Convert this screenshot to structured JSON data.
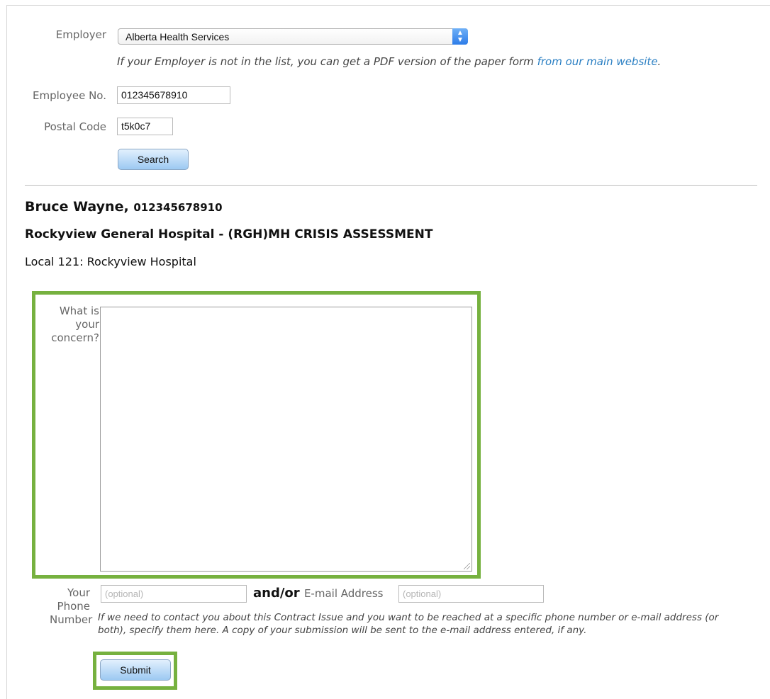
{
  "employer": {
    "label": "Employer",
    "selected": "Alberta Health Services",
    "hint_prefix": "If your Employer is not in the list, you can get a PDF version of the paper form ",
    "hint_link": "from our main website",
    "hint_suffix": "."
  },
  "employee_no": {
    "label": "Employee No.",
    "value": "012345678910"
  },
  "postal_code": {
    "label": "Postal Code",
    "value": "t5k0c7"
  },
  "search_button": "Search",
  "result": {
    "name": "Bruce Wayne,",
    "number": "012345678910",
    "worksite": "Rockyview General Hospital - (RGH)MH CRISIS ASSESSMENT",
    "local": "Local 121: Rockyview Hospital"
  },
  "concern": {
    "label_line1": "What is",
    "label_line2": "your",
    "label_line3": "concern?",
    "value": ""
  },
  "phone": {
    "label_line1": "Your",
    "label_line2": "Phone",
    "label_line3": "Number",
    "placeholder": "(optional)"
  },
  "and_or": "and/or",
  "email": {
    "label": "E-mail Address",
    "placeholder": "(optional)"
  },
  "contact_note": "If we need to contact you about this Contract Issue and you want to be reached at a specific phone number or e-mail address (or both), specify them here. A copy of your submission will be sent to the e-mail address entered, if any.",
  "submit_button": "Submit",
  "icons": {
    "select_arrows": "chevron-updown-icon",
    "resize_grip": "resize-grip-icon"
  },
  "colors": {
    "highlight": "#76b13f",
    "link": "#2a7fc3",
    "button": "#9cc9f2"
  }
}
